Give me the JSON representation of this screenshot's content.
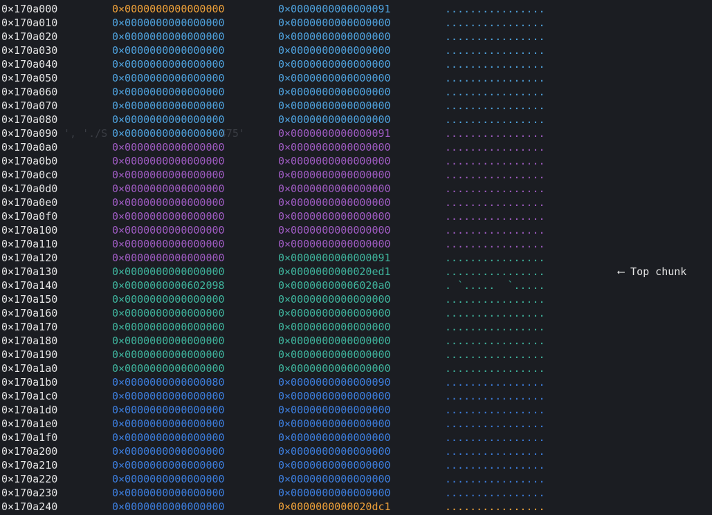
{
  "colors": {
    "address": "#e6e6e6",
    "header_value": "#f0a23a",
    "chunk1": "#4fa3df",
    "chunk2": "#a05cc4",
    "chunk3": "#3fb59e",
    "chunk4": "#3d7fe0",
    "annotation": "#e6e6e6"
  },
  "annotation": "⟵ Top chunk",
  "background_text": "', './S                  475'",
  "rows": [
    {
      "addr": "0×170a000",
      "q1": "0×0000000000000000",
      "q2": "0×0000000000000091",
      "ascii": "................",
      "c1": "#f0a23a",
      "c2": "#4fa3df",
      "ca": "#4fa3df"
    },
    {
      "addr": "0×170a010",
      "q1": "0×0000000000000000",
      "q2": "0×0000000000000000",
      "ascii": "................",
      "c1": "#4fa3df",
      "c2": "#4fa3df",
      "ca": "#4fa3df"
    },
    {
      "addr": "0×170a020",
      "q1": "0×0000000000000000",
      "q2": "0×0000000000000000",
      "ascii": "................",
      "c1": "#4fa3df",
      "c2": "#4fa3df",
      "ca": "#4fa3df"
    },
    {
      "addr": "0×170a030",
      "q1": "0×0000000000000000",
      "q2": "0×0000000000000000",
      "ascii": "................",
      "c1": "#4fa3df",
      "c2": "#4fa3df",
      "ca": "#4fa3df"
    },
    {
      "addr": "0×170a040",
      "q1": "0×0000000000000000",
      "q2": "0×0000000000000000",
      "ascii": "................",
      "c1": "#4fa3df",
      "c2": "#4fa3df",
      "ca": "#4fa3df"
    },
    {
      "addr": "0×170a050",
      "q1": "0×0000000000000000",
      "q2": "0×0000000000000000",
      "ascii": "................",
      "c1": "#4fa3df",
      "c2": "#4fa3df",
      "ca": "#4fa3df"
    },
    {
      "addr": "0×170a060",
      "q1": "0×0000000000000000",
      "q2": "0×0000000000000000",
      "ascii": "................",
      "c1": "#4fa3df",
      "c2": "#4fa3df",
      "ca": "#4fa3df"
    },
    {
      "addr": "0×170a070",
      "q1": "0×0000000000000000",
      "q2": "0×0000000000000000",
      "ascii": "................",
      "c1": "#4fa3df",
      "c2": "#4fa3df",
      "ca": "#4fa3df"
    },
    {
      "addr": "0×170a080",
      "q1": "0×0000000000000000",
      "q2": "0×0000000000000000",
      "ascii": "................",
      "c1": "#4fa3df",
      "c2": "#4fa3df",
      "ca": "#4fa3df"
    },
    {
      "addr": "0×170a090",
      "q1": "0×0000000000000000",
      "q2": "0×0000000000000091",
      "ascii": "................",
      "c1": "#4fa3df",
      "c2": "#a05cc4",
      "ca": "#a05cc4"
    },
    {
      "addr": "0×170a0a0",
      "q1": "0×0000000000000000",
      "q2": "0×0000000000000000",
      "ascii": "................",
      "c1": "#a05cc4",
      "c2": "#a05cc4",
      "ca": "#a05cc4"
    },
    {
      "addr": "0×170a0b0",
      "q1": "0×0000000000000000",
      "q2": "0×0000000000000000",
      "ascii": "................",
      "c1": "#a05cc4",
      "c2": "#a05cc4",
      "ca": "#a05cc4"
    },
    {
      "addr": "0×170a0c0",
      "q1": "0×0000000000000000",
      "q2": "0×0000000000000000",
      "ascii": "................",
      "c1": "#a05cc4",
      "c2": "#a05cc4",
      "ca": "#a05cc4"
    },
    {
      "addr": "0×170a0d0",
      "q1": "0×0000000000000000",
      "q2": "0×0000000000000000",
      "ascii": "................",
      "c1": "#a05cc4",
      "c2": "#a05cc4",
      "ca": "#a05cc4"
    },
    {
      "addr": "0×170a0e0",
      "q1": "0×0000000000000000",
      "q2": "0×0000000000000000",
      "ascii": "................",
      "c1": "#a05cc4",
      "c2": "#a05cc4",
      "ca": "#a05cc4"
    },
    {
      "addr": "0×170a0f0",
      "q1": "0×0000000000000000",
      "q2": "0×0000000000000000",
      "ascii": "................",
      "c1": "#a05cc4",
      "c2": "#a05cc4",
      "ca": "#a05cc4"
    },
    {
      "addr": "0×170a100",
      "q1": "0×0000000000000000",
      "q2": "0×0000000000000000",
      "ascii": "................",
      "c1": "#a05cc4",
      "c2": "#a05cc4",
      "ca": "#a05cc4"
    },
    {
      "addr": "0×170a110",
      "q1": "0×0000000000000000",
      "q2": "0×0000000000000000",
      "ascii": "................",
      "c1": "#a05cc4",
      "c2": "#a05cc4",
      "ca": "#a05cc4"
    },
    {
      "addr": "0×170a120",
      "q1": "0×0000000000000000",
      "q2": "0×0000000000000091",
      "ascii": "................",
      "c1": "#a05cc4",
      "c2": "#3fb59e",
      "ca": "#3fb59e"
    },
    {
      "addr": "0×170a130",
      "q1": "0×0000000000000000",
      "q2": "0×0000000000020ed1",
      "ascii": "................",
      "c1": "#3fb59e",
      "c2": "#3fb59e",
      "ca": "#3fb59e"
    },
    {
      "addr": "0×170a140",
      "q1": "0×0000000000602098",
      "q2": "0×00000000006020a0",
      "ascii": ". `.....  `.....",
      "c1": "#3fb59e",
      "c2": "#3fb59e",
      "ca": "#3fb59e"
    },
    {
      "addr": "0×170a150",
      "q1": "0×0000000000000000",
      "q2": "0×0000000000000000",
      "ascii": "................",
      "c1": "#3fb59e",
      "c2": "#3fb59e",
      "ca": "#3fb59e"
    },
    {
      "addr": "0×170a160",
      "q1": "0×0000000000000000",
      "q2": "0×0000000000000000",
      "ascii": "................",
      "c1": "#3fb59e",
      "c2": "#3fb59e",
      "ca": "#3fb59e"
    },
    {
      "addr": "0×170a170",
      "q1": "0×0000000000000000",
      "q2": "0×0000000000000000",
      "ascii": "................",
      "c1": "#3fb59e",
      "c2": "#3fb59e",
      "ca": "#3fb59e"
    },
    {
      "addr": "0×170a180",
      "q1": "0×0000000000000000",
      "q2": "0×0000000000000000",
      "ascii": "................",
      "c1": "#3fb59e",
      "c2": "#3fb59e",
      "ca": "#3fb59e"
    },
    {
      "addr": "0×170a190",
      "q1": "0×0000000000000000",
      "q2": "0×0000000000000000",
      "ascii": "................",
      "c1": "#3fb59e",
      "c2": "#3fb59e",
      "ca": "#3fb59e"
    },
    {
      "addr": "0×170a1a0",
      "q1": "0×0000000000000000",
      "q2": "0×0000000000000000",
      "ascii": "................",
      "c1": "#3fb59e",
      "c2": "#3fb59e",
      "ca": "#3fb59e"
    },
    {
      "addr": "0×170a1b0",
      "q1": "0×0000000000000080",
      "q2": "0×0000000000000090",
      "ascii": "................",
      "c1": "#3d7fe0",
      "c2": "#3d7fe0",
      "ca": "#3d7fe0"
    },
    {
      "addr": "0×170a1c0",
      "q1": "0×0000000000000000",
      "q2": "0×0000000000000000",
      "ascii": "................",
      "c1": "#3d7fe0",
      "c2": "#3d7fe0",
      "ca": "#3d7fe0"
    },
    {
      "addr": "0×170a1d0",
      "q1": "0×0000000000000000",
      "q2": "0×0000000000000000",
      "ascii": "................",
      "c1": "#3d7fe0",
      "c2": "#3d7fe0",
      "ca": "#3d7fe0"
    },
    {
      "addr": "0×170a1e0",
      "q1": "0×0000000000000000",
      "q2": "0×0000000000000000",
      "ascii": "................",
      "c1": "#3d7fe0",
      "c2": "#3d7fe0",
      "ca": "#3d7fe0"
    },
    {
      "addr": "0×170a1f0",
      "q1": "0×0000000000000000",
      "q2": "0×0000000000000000",
      "ascii": "................",
      "c1": "#3d7fe0",
      "c2": "#3d7fe0",
      "ca": "#3d7fe0"
    },
    {
      "addr": "0×170a200",
      "q1": "0×0000000000000000",
      "q2": "0×0000000000000000",
      "ascii": "................",
      "c1": "#3d7fe0",
      "c2": "#3d7fe0",
      "ca": "#3d7fe0"
    },
    {
      "addr": "0×170a210",
      "q1": "0×0000000000000000",
      "q2": "0×0000000000000000",
      "ascii": "................",
      "c1": "#3d7fe0",
      "c2": "#3d7fe0",
      "ca": "#3d7fe0"
    },
    {
      "addr": "0×170a220",
      "q1": "0×0000000000000000",
      "q2": "0×0000000000000000",
      "ascii": "................",
      "c1": "#3d7fe0",
      "c2": "#3d7fe0",
      "ca": "#3d7fe0"
    },
    {
      "addr": "0×170a230",
      "q1": "0×0000000000000000",
      "q2": "0×0000000000000000",
      "ascii": "................",
      "c1": "#3d7fe0",
      "c2": "#3d7fe0",
      "ca": "#3d7fe0"
    },
    {
      "addr": "0×170a240",
      "q1": "0×0000000000000000",
      "q2": "0×0000000000020dc1",
      "ascii": "................",
      "c1": "#3d7fe0",
      "c2": "#f0a23a",
      "ca": "#f0a23a"
    }
  ]
}
